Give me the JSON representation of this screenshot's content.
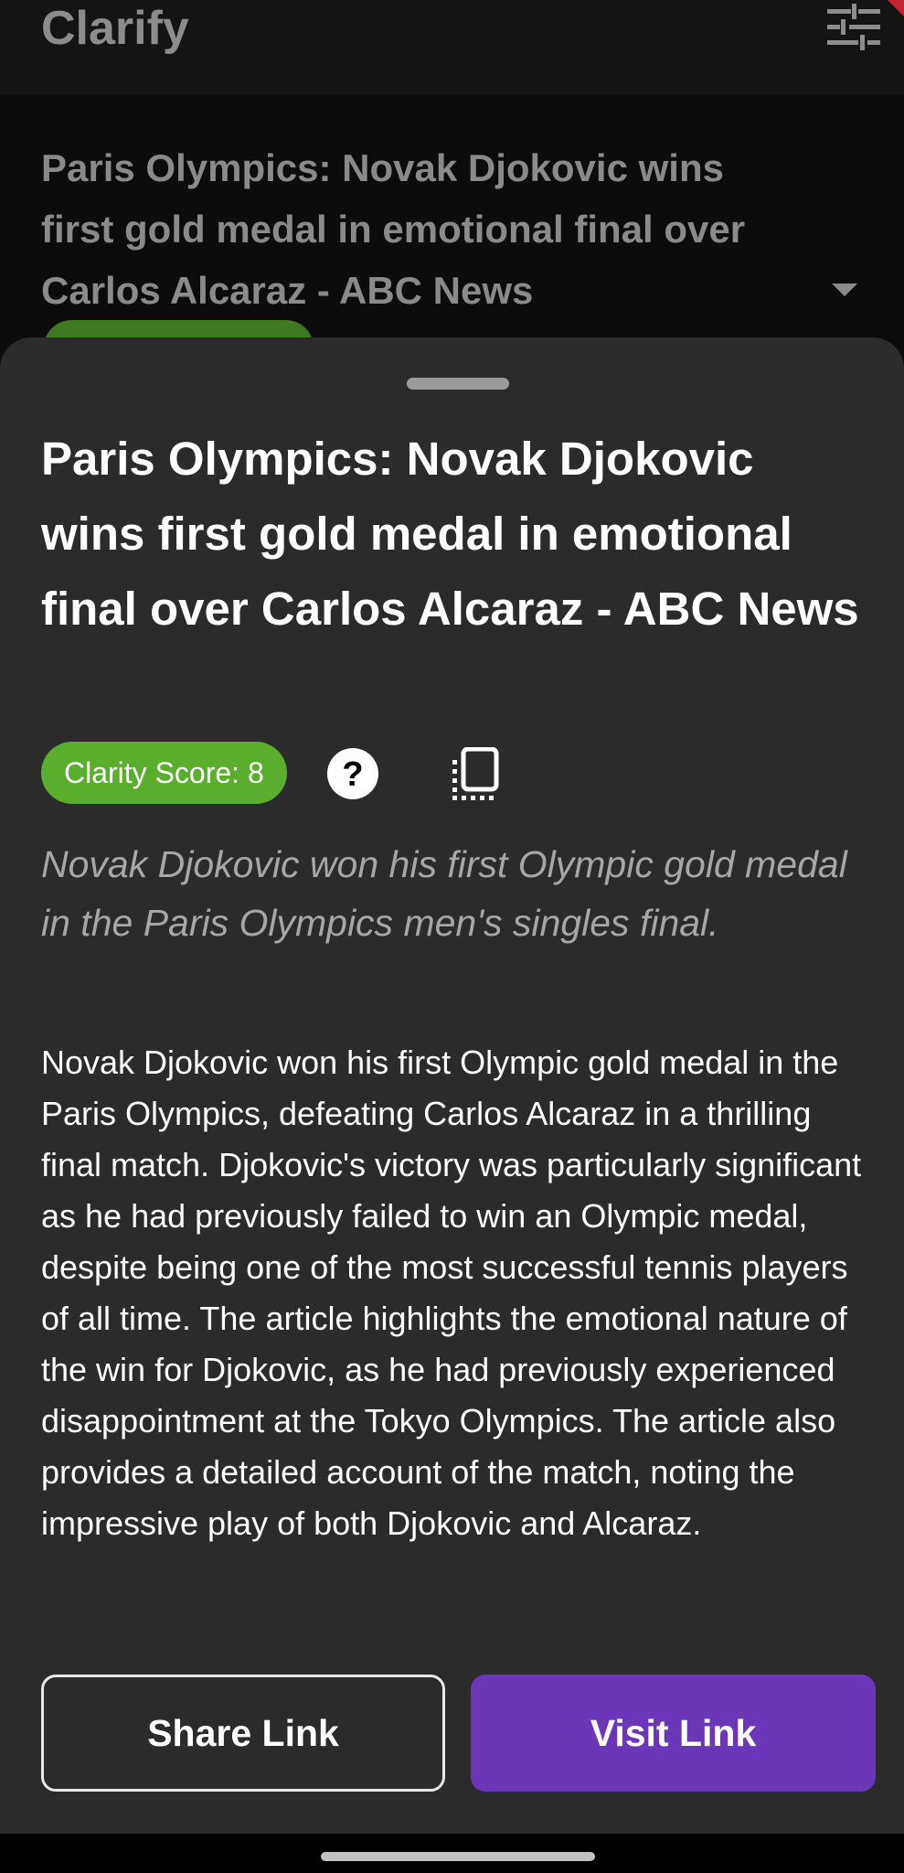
{
  "app": {
    "title": "Clarify",
    "filter_icon": "tune-sliders-icon"
  },
  "background_list": {
    "article_title": "Paris Olympics: Novak Djokovic wins first gold medal in emotional final over Carlos Alcaraz - ABC News",
    "expand_icon": "chevron-down-icon"
  },
  "sheet": {
    "title": "Paris Olympics: Novak Djokovic wins first gold medal in emotional final over Carlos Alcaraz - ABC News",
    "clarity_score_label": "Clarity Score: 8",
    "help_icon": "question-circle-icon",
    "copy_icon": "copy-icon",
    "short_summary": "Novak Djokovic won his first Olympic gold medal in the Paris Olympics men's singles final.",
    "long_summary": "Novak Djokovic won his first Olympic gold medal in the Paris Olympics, defeating Carlos Alcaraz in a thrilling final match. Djokovic's victory was particularly significant as he had previously failed to win an Olympic medal, despite being one of the most successful tennis players of all time. The article highlights the emotional nature of the win for Djokovic, as he had previously experienced disappointment at the Tokyo Olympics.  The article also provides a detailed account of the match, noting the impressive play of both Djokovic and Alcaraz.",
    "share_button": "Share Link",
    "visit_button": "Visit Link"
  },
  "colors": {
    "sheet_background": "#2b2b2b",
    "score_badge": "#5aae2e",
    "visit_button": "#6a37b8",
    "summary_italic": "#a7a7a7"
  }
}
